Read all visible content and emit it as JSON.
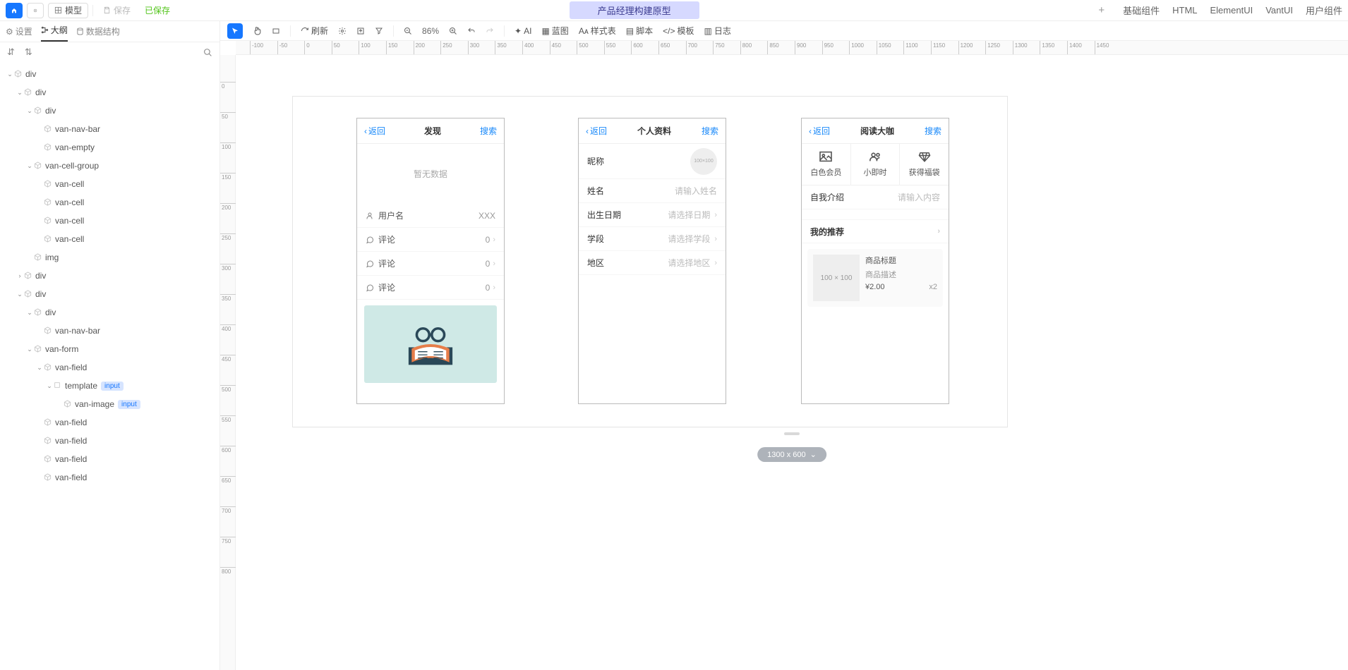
{
  "top": {
    "model": "模型",
    "save": "保存",
    "saved": "已保存",
    "title": "产品经理构建原型",
    "tabs": [
      "基础组件",
      "HTML",
      "ElementUI",
      "VantUI",
      "用户组件"
    ]
  },
  "leftTabs": {
    "settings": "设置",
    "outline": "大纲",
    "data": "数据结构"
  },
  "tree": [
    {
      "d": 0,
      "a": true,
      "i": "cube",
      "t": "div"
    },
    {
      "d": 1,
      "a": true,
      "i": "cube",
      "t": "div"
    },
    {
      "d": 2,
      "a": true,
      "i": "cube",
      "t": "div"
    },
    {
      "d": 3,
      "a": false,
      "i": "cube",
      "t": "van-nav-bar"
    },
    {
      "d": 3,
      "a": false,
      "i": "cube",
      "t": "van-empty"
    },
    {
      "d": 2,
      "a": true,
      "i": "cube",
      "t": "van-cell-group"
    },
    {
      "d": 3,
      "a": false,
      "i": "cube",
      "t": "van-cell"
    },
    {
      "d": 3,
      "a": false,
      "i": "cube",
      "t": "van-cell"
    },
    {
      "d": 3,
      "a": false,
      "i": "cube",
      "t": "van-cell"
    },
    {
      "d": 3,
      "a": false,
      "i": "cube",
      "t": "van-cell"
    },
    {
      "d": 2,
      "a": false,
      "i": "cube",
      "t": "img"
    },
    {
      "d": 1,
      "a": false,
      "ar": true,
      "i": "cube",
      "t": "div"
    },
    {
      "d": 1,
      "a": true,
      "i": "cube",
      "t": "div"
    },
    {
      "d": 2,
      "a": true,
      "i": "cube",
      "t": "div"
    },
    {
      "d": 3,
      "a": false,
      "i": "cube",
      "t": "van-nav-bar"
    },
    {
      "d": 2,
      "a": true,
      "i": "cube",
      "t": "van-form"
    },
    {
      "d": 3,
      "a": true,
      "i": "cube",
      "t": "van-field"
    },
    {
      "d": 4,
      "a": true,
      "i": "sq",
      "t": "template",
      "b": "input"
    },
    {
      "d": 5,
      "a": false,
      "i": "cube",
      "t": "van-image",
      "b": "input"
    },
    {
      "d": 3,
      "a": false,
      "i": "cube",
      "t": "van-field"
    },
    {
      "d": 3,
      "a": false,
      "i": "cube",
      "t": "van-field"
    },
    {
      "d": 3,
      "a": false,
      "i": "cube",
      "t": "van-field"
    },
    {
      "d": 3,
      "a": false,
      "i": "cube",
      "t": "van-field"
    }
  ],
  "toolbar": {
    "refresh": "刷新",
    "zoom": "86%",
    "ai": "AI",
    "blueprint": "蓝图",
    "style": "样式表",
    "script": "脚本",
    "tpl": "模板",
    "log": "日志"
  },
  "p1": {
    "back": "返回",
    "title": "发现",
    "search": "搜索",
    "empty": "暂无数据",
    "user": "用户名",
    "userv": "XXX",
    "c": "评论",
    "cv": "0"
  },
  "p2": {
    "back": "返回",
    "title": "个人资料",
    "search": "搜索",
    "nick": "昵称",
    "name": "姓名",
    "nameP": "请输入姓名",
    "birth": "出生日期",
    "birthP": "请选择日期",
    "stage": "学段",
    "stageP": "请选择学段",
    "area": "地区",
    "areaP": "请选择地区"
  },
  "p3": {
    "back": "返回",
    "title": "阅读大咖",
    "search": "搜索",
    "g1": "白色会员",
    "g2": "小即时",
    "g3": "获得福袋",
    "intro": "自我介绍",
    "introP": "请输入内容",
    "rec": "我的推荐",
    "card": {
      "img": "100 × 100",
      "title": "商品标题",
      "desc": "商品描述",
      "price": "¥2.00",
      "qty": "x2"
    }
  },
  "size": "1300 x 600",
  "hticks": [
    -100,
    -50,
    0,
    50,
    100,
    150,
    200,
    250,
    300,
    350,
    400,
    450,
    500,
    550,
    600,
    650,
    700,
    750,
    800,
    850,
    900,
    950,
    1000,
    1050,
    1100,
    1150,
    1200,
    1250,
    1300,
    1350,
    1400,
    1450
  ],
  "vticks": [
    0,
    50,
    100,
    150,
    200,
    250,
    300,
    350,
    400,
    450,
    500,
    550,
    600,
    650,
    700,
    750,
    800
  ]
}
